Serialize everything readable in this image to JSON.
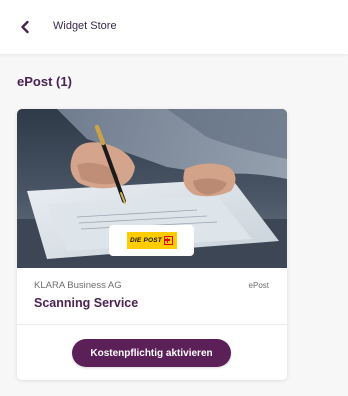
{
  "header": {
    "back_icon": "chevron-left-icon",
    "title": "Widget Store"
  },
  "section": {
    "title": "ePost (1)"
  },
  "cards": [
    {
      "image": "photo of hand signing a document with a pen",
      "logo_text": "DIE POST",
      "vendor": "KLARA Business AG",
      "category": "ePost",
      "name": "Scanning Service",
      "action_label": "Kostenpflichtig aktivieren"
    }
  ],
  "colors": {
    "accent": "#5b2058",
    "title": "#4a2352",
    "background": "#f7f7f7",
    "logo_yellow": "#ffcc00",
    "logo_red": "#e30613"
  }
}
